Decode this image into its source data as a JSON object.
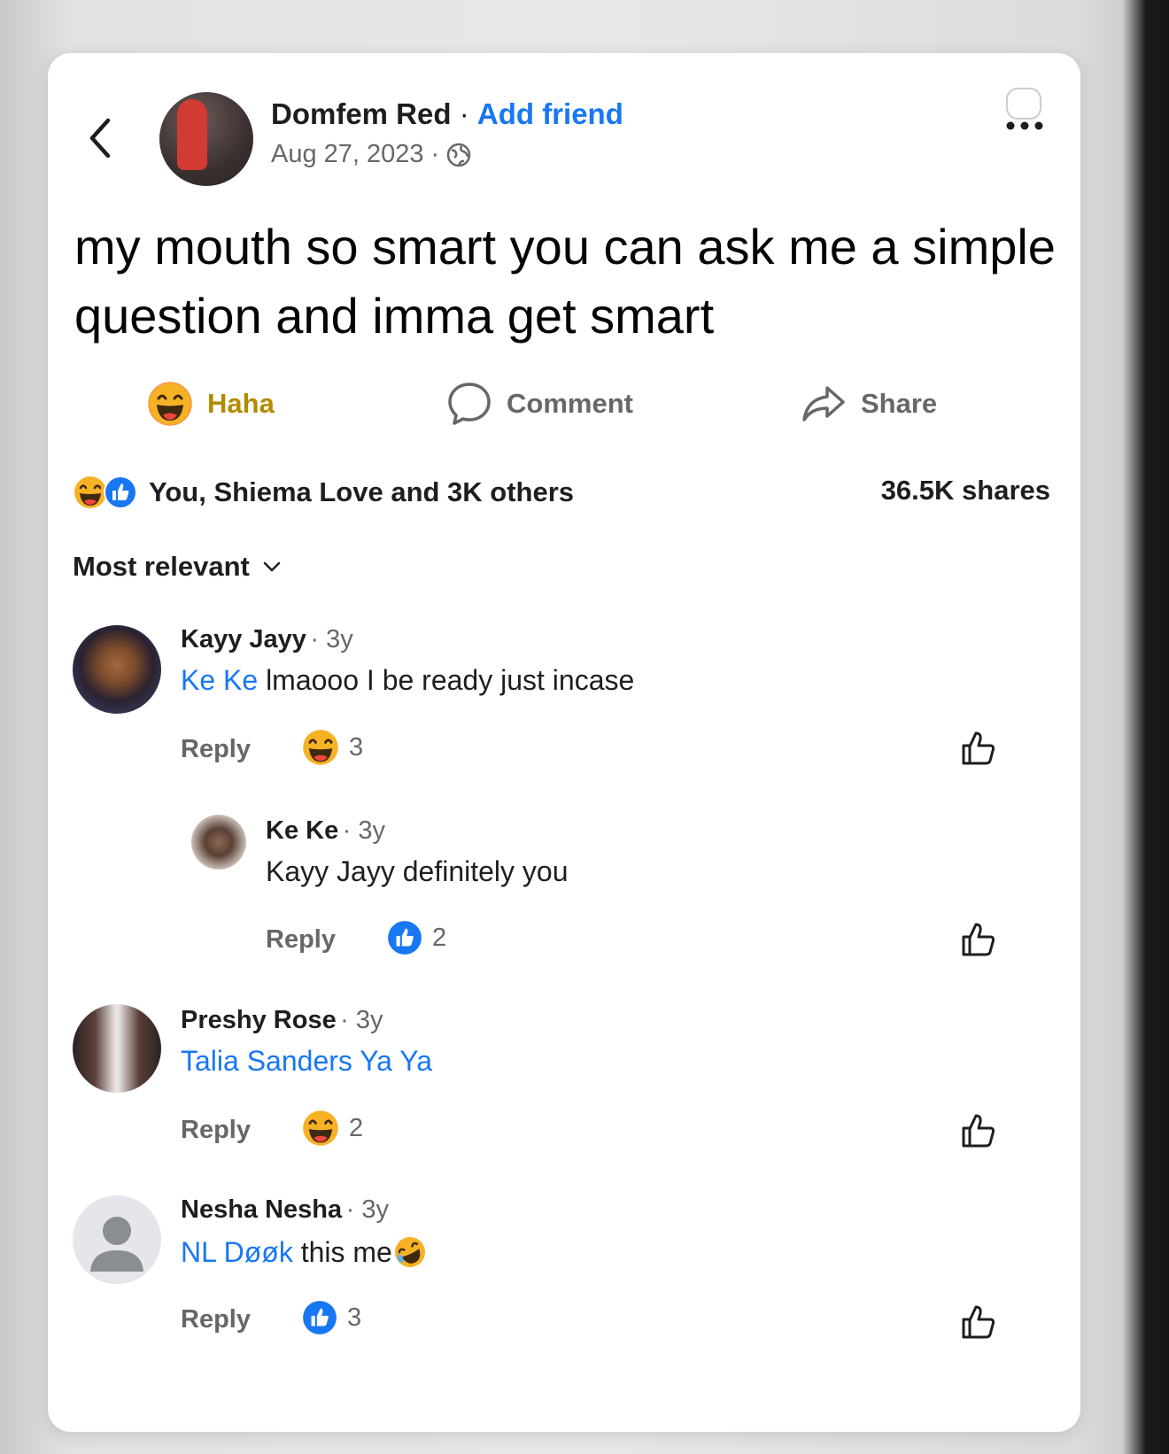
{
  "post": {
    "author": "Domfem Red",
    "separator": "·",
    "add_friend": "Add friend",
    "date": "Aug 27, 2023",
    "date_separator": "·",
    "text": "my mouth so smart you can ask me a simple question and imma get smart"
  },
  "actions": {
    "haha": "Haha",
    "comment": "Comment",
    "share": "Share"
  },
  "stats": {
    "reactions": "You, Shiema Love and 3K others",
    "shares": "36.5K shares"
  },
  "sort": {
    "label": "Most relevant"
  },
  "comments": [
    {
      "name": "Kayy Jayy",
      "time": "· 3y",
      "mention": "Ke Ke",
      "text": " lmaooo I be ready just incase",
      "reply": "Reply",
      "reaction": "haha",
      "count": "3"
    },
    {
      "name": "Ke Ke",
      "time": "· 3y",
      "mention": "",
      "text": "Kayy Jayy definitely you",
      "reply": "Reply",
      "reaction": "like",
      "count": "2"
    },
    {
      "name": "Preshy Rose",
      "time": "· 3y",
      "mention": "Talia Sanders Ya Ya",
      "text": "",
      "reply": "Reply",
      "reaction": "haha",
      "count": "2"
    },
    {
      "name": "Nesha Nesha",
      "time": "· 3y",
      "mention": "NL Døøk",
      "text": " this me",
      "reply": "Reply",
      "reaction": "like",
      "count": "3"
    }
  ],
  "colors": {
    "accent": "#1877f2",
    "muted": "#65676b",
    "haha": "#f7b125"
  },
  "icons": [
    "back-icon",
    "globe-icon",
    "more-icon",
    "haha-icon",
    "comment-icon",
    "share-icon",
    "like-icon",
    "chevron-down-icon",
    "rofl-icon"
  ]
}
